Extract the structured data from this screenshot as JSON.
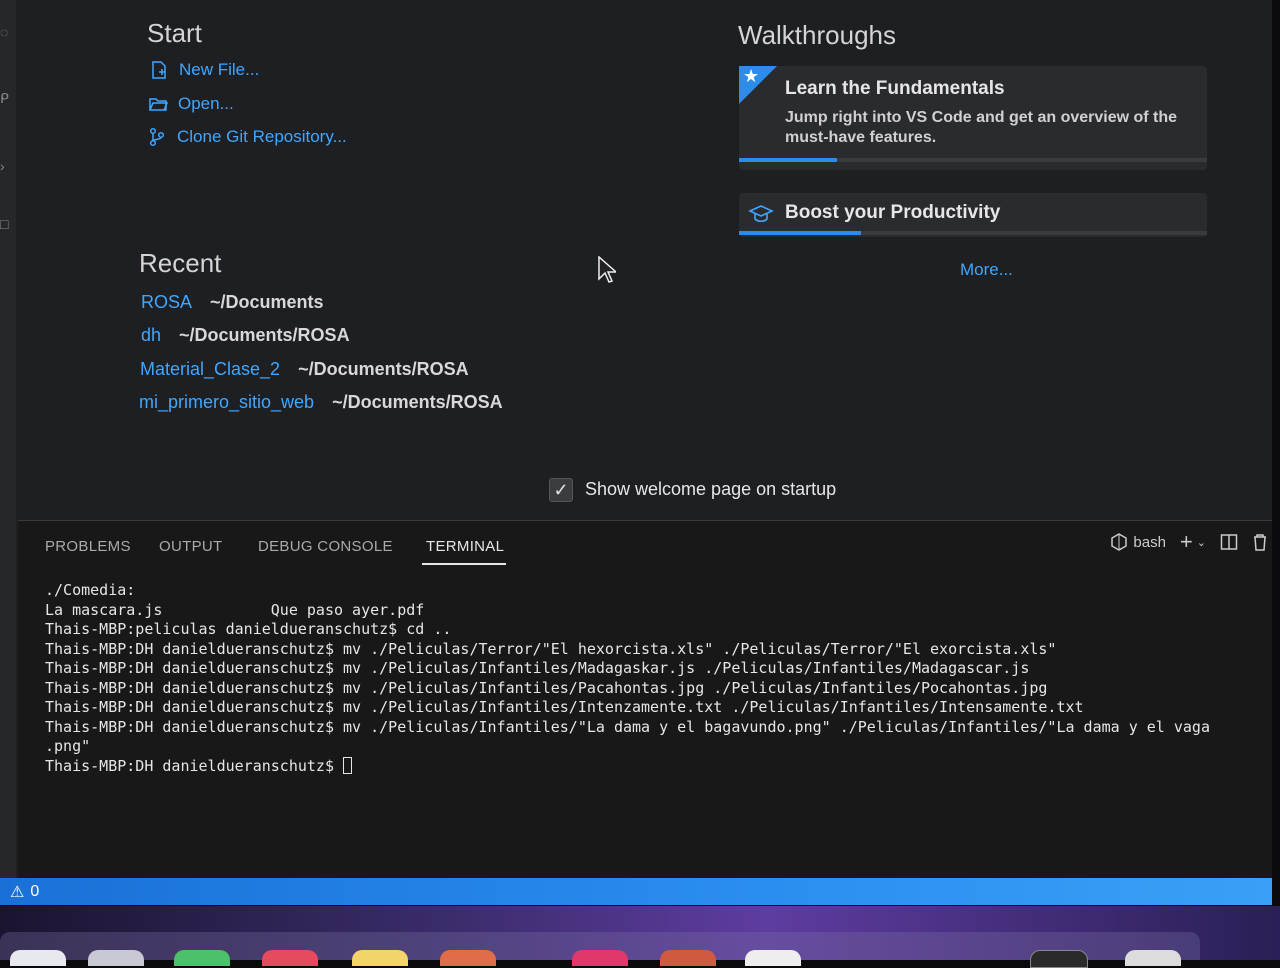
{
  "start": {
    "title": "Start",
    "items": [
      {
        "label": "New File...",
        "icon": "new-file-icon"
      },
      {
        "label": "Open...",
        "icon": "folder-icon"
      },
      {
        "label": "Clone Git Repository...",
        "icon": "git-branch-icon"
      }
    ]
  },
  "recent": {
    "title": "Recent",
    "items": [
      {
        "name": "ROSA",
        "path": "~/Documents"
      },
      {
        "name": "dh",
        "path": "~/Documents/ROSA"
      },
      {
        "name": "Material_Clase_2",
        "path": "~/Documents/ROSA"
      },
      {
        "name": "mi_primero_sitio_web",
        "path": "~/Documents/ROSA"
      }
    ]
  },
  "walkthroughs": {
    "title": "Walkthroughs",
    "cards": [
      {
        "title": "Learn the Fundamentals",
        "description": "Jump right into VS Code and get an overview of the must-have features.",
        "progress": 0.21
      },
      {
        "title": "Boost your Productivity",
        "description": "",
        "progress": 0.26
      }
    ],
    "more_label": "More..."
  },
  "startup": {
    "label": "Show welcome page on startup",
    "checked": true
  },
  "panel": {
    "tabs": [
      "PROBLEMS",
      "OUTPUT",
      "DEBUG CONSOLE",
      "TERMINAL"
    ],
    "active_tab": "TERMINAL",
    "shell": "bash"
  },
  "terminal": {
    "lines": [
      "./Comedia:",
      "La mascara.js            Que paso ayer.pdf",
      "Thais-MBP:peliculas danieldueranschutz$ cd ..",
      "Thais-MBP:DH danieldueranschutz$ mv ./Peliculas/Terror/\"El hexorcista.xls\" ./Peliculas/Terror/\"El exorcista.xls\"",
      "Thais-MBP:DH danieldueranschutz$ mv ./Peliculas/Infantiles/Madagaskar.js ./Peliculas/Infantiles/Madagascar.js",
      "Thais-MBP:DH danieldueranschutz$ mv ./Peliculas/Infantiles/Pacahontas.jpg ./Peliculas/Infantiles/Pocahontas.jpg",
      "Thais-MBP:DH danieldueranschutz$ mv ./Peliculas/Infantiles/Intenzamente.txt ./Peliculas/Infantiles/Intensamente.txt",
      "Thais-MBP:DH danieldueranschutz$ mv ./Peliculas/Infantiles/\"La dama y el bagavundo.png\" ./Peliculas/Infantiles/\"La dama y el vaga",
      ".png\""
    ],
    "prompt": "Thais-MBP:DH danieldueranschutz$ "
  },
  "status": {
    "warnings": "0"
  }
}
